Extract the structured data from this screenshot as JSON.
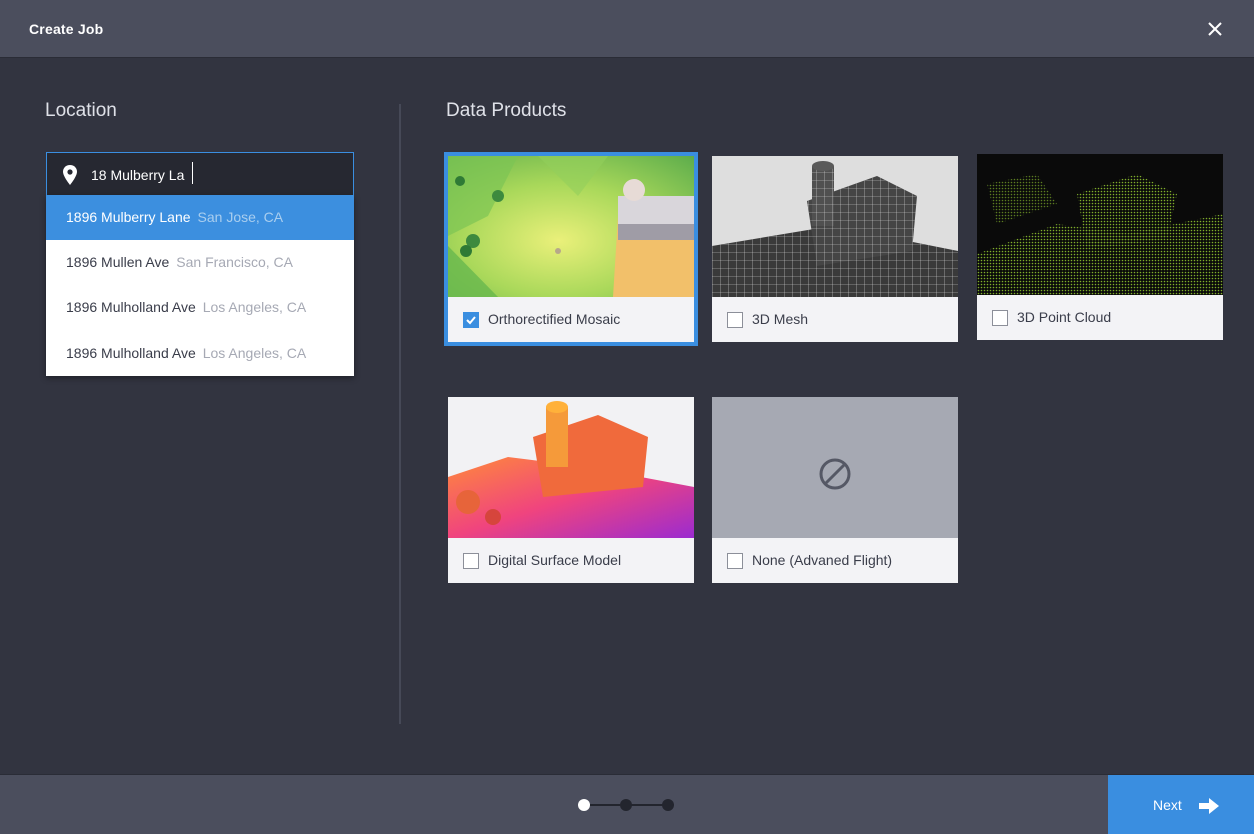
{
  "header": {
    "title": "Create Job",
    "close_icon": "close-icon"
  },
  "location": {
    "title": "Location",
    "search": {
      "value": "18 Mulberry La",
      "icon": "map-pin-icon"
    },
    "suggestions": [
      {
        "street": "1896 Mulberry Lane",
        "city": "San Jose, CA",
        "active": true
      },
      {
        "street": "1896 Mullen Ave",
        "city": "San Francisco, CA",
        "active": false
      },
      {
        "street": "1896 Mulholland Ave",
        "city": "Los Angeles, CA",
        "active": false
      },
      {
        "street": "1896 Mulholland Ave",
        "city": "Los Angeles, CA",
        "active": false
      }
    ]
  },
  "products": {
    "title": "Data Products",
    "items": [
      {
        "label": "Orthorectified Mosaic",
        "checked": true
      },
      {
        "label": "3D Mesh",
        "checked": false
      },
      {
        "label": "3D Point Cloud",
        "checked": false
      },
      {
        "label": "Digital Surface Model",
        "checked": false
      },
      {
        "label": "None (Advaned Flight)",
        "checked": false,
        "icon": "no-symbol-icon"
      }
    ]
  },
  "footer": {
    "steps": {
      "total": 3,
      "current": 1
    },
    "next_label": "Next",
    "next_icon": "arrow-right-icon"
  },
  "colors": {
    "accent": "#3a8ee0",
    "background": "#323440",
    "header": "#4b4e5d"
  }
}
